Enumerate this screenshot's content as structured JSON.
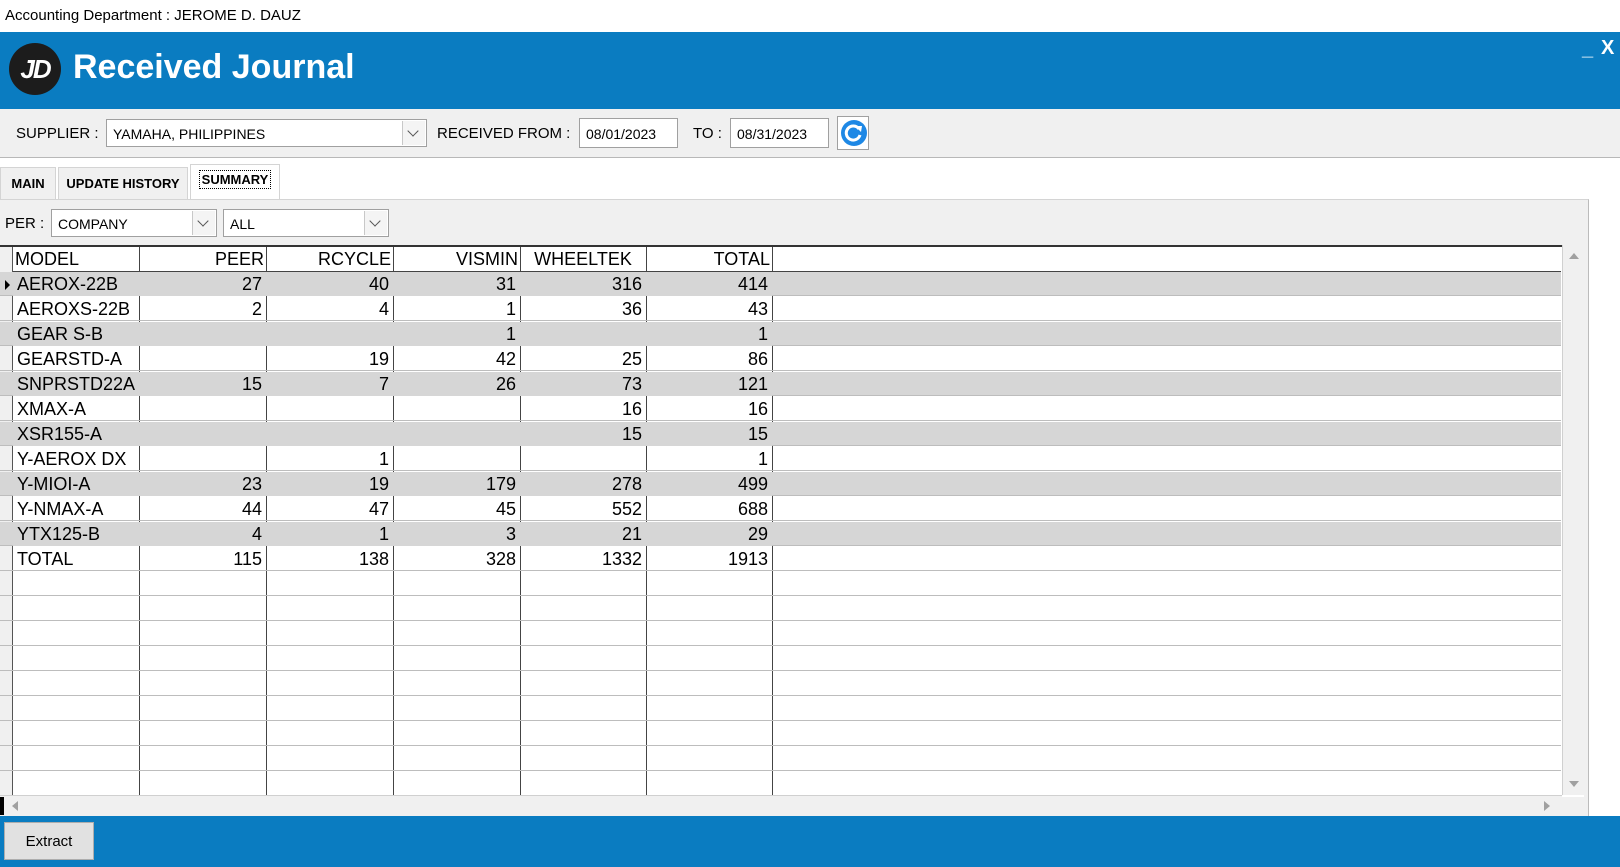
{
  "window": {
    "caption": "Accounting Department : JEROME D. DAUZ",
    "app_title": "Received Journal",
    "logo_text": "JD",
    "minimize": "_",
    "close": "X"
  },
  "toolbar": {
    "supplier_label": "SUPPLIER :",
    "supplier_value": "YAMAHA, PHILIPPINES",
    "received_from_label": "RECEIVED FROM :",
    "received_from_value": "08/01/2023",
    "to_label": "TO :",
    "to_value": "08/31/2023",
    "refresh_icon": "refresh-icon"
  },
  "tabs": [
    {
      "label": "MAIN"
    },
    {
      "label": "UPDATE HISTORY"
    },
    {
      "label": "SUMMARY",
      "active": true
    }
  ],
  "filter": {
    "per_label": "PER :",
    "per_value": "COMPANY",
    "scope_value": "ALL"
  },
  "grid": {
    "columns": [
      "MODEL",
      "PEER",
      "RCYCLE",
      "VISMIN",
      "WHEELTEK",
      "TOTAL"
    ],
    "rows": [
      {
        "model": "AEROX-22B",
        "peer": "27",
        "rcycle": "40",
        "vismin": "31",
        "wheeltek": "316",
        "total": "414"
      },
      {
        "model": "AEROXS-22B",
        "peer": "2",
        "rcycle": "4",
        "vismin": "1",
        "wheeltek": "36",
        "total": "43"
      },
      {
        "model": "GEAR S-B",
        "peer": "",
        "rcycle": "",
        "vismin": "1",
        "wheeltek": "",
        "total": "1"
      },
      {
        "model": "GEARSTD-A",
        "peer": "",
        "rcycle": "19",
        "vismin": "42",
        "wheeltek": "25",
        "total": "86"
      },
      {
        "model": "SNPRSTD22A",
        "peer": "15",
        "rcycle": "7",
        "vismin": "26",
        "wheeltek": "73",
        "total": "121"
      },
      {
        "model": "XMAX-A",
        "peer": "",
        "rcycle": "",
        "vismin": "",
        "wheeltek": "16",
        "total": "16"
      },
      {
        "model": "XSR155-A",
        "peer": "",
        "rcycle": "",
        "vismin": "",
        "wheeltek": "15",
        "total": "15"
      },
      {
        "model": "Y-AEROX DX",
        "peer": "",
        "rcycle": "1",
        "vismin": "",
        "wheeltek": "",
        "total": "1"
      },
      {
        "model": "Y-MIOI-A",
        "peer": "23",
        "rcycle": "19",
        "vismin": "179",
        "wheeltek": "278",
        "total": "499"
      },
      {
        "model": "Y-NMAX-A",
        "peer": "44",
        "rcycle": "47",
        "vismin": "45",
        "wheeltek": "552",
        "total": "688"
      },
      {
        "model": "YTX125-B",
        "peer": "4",
        "rcycle": "1",
        "vismin": "3",
        "wheeltek": "21",
        "total": "29"
      },
      {
        "model": "TOTAL",
        "peer": "115",
        "rcycle": "138",
        "vismin": "328",
        "wheeltek": "1332",
        "total": "1913"
      }
    ]
  },
  "footer": {
    "extract_label": "Extract"
  },
  "colors": {
    "brand_blue": "#0a7cc1",
    "row_shade": "#d6d6d6"
  }
}
